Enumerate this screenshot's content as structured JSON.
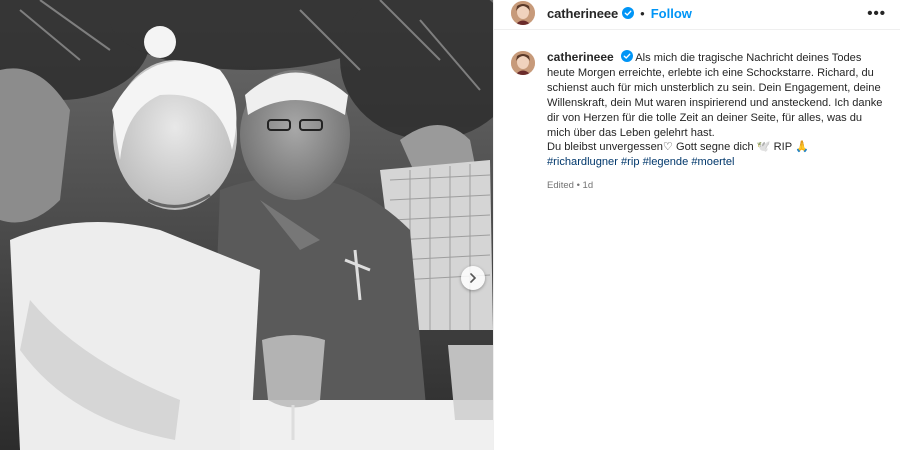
{
  "post": {
    "username": "catherineee",
    "follow_label": "Follow",
    "more_label": "•••",
    "dot": "•"
  },
  "caption": {
    "username": "catherineee",
    "text": "Als mich die tragische Nachricht deines Todes heute Morgen erreichte, erlebte ich eine Schockstarre. Richard, du schienst auch für mich unsterblich zu sein. Dein Engagement, deine Willenskraft, dein Mut waren inspirierend und ansteckend. Ich danke dir von Herzen für die tolle Zeit an deiner Seite, für alles, was du mich über das Leben gelehrt hast.\nDu bleibst unvergessen♡ Gott segne dich 🕊️ RIP 🙏",
    "hashtags": [
      "#richardlugner",
      "#rip",
      "#legende",
      "#moertel"
    ],
    "edited": "Edited",
    "time": "1d",
    "meta_sep": "•"
  },
  "colors": {
    "link": "#0095f6",
    "hashtag": "#00376b",
    "verified": "#0095f6",
    "muted": "#737373"
  },
  "icons": {
    "verified": "verified-badge-icon",
    "more": "more-options-icon",
    "carousel_next": "chevron-right-icon"
  }
}
